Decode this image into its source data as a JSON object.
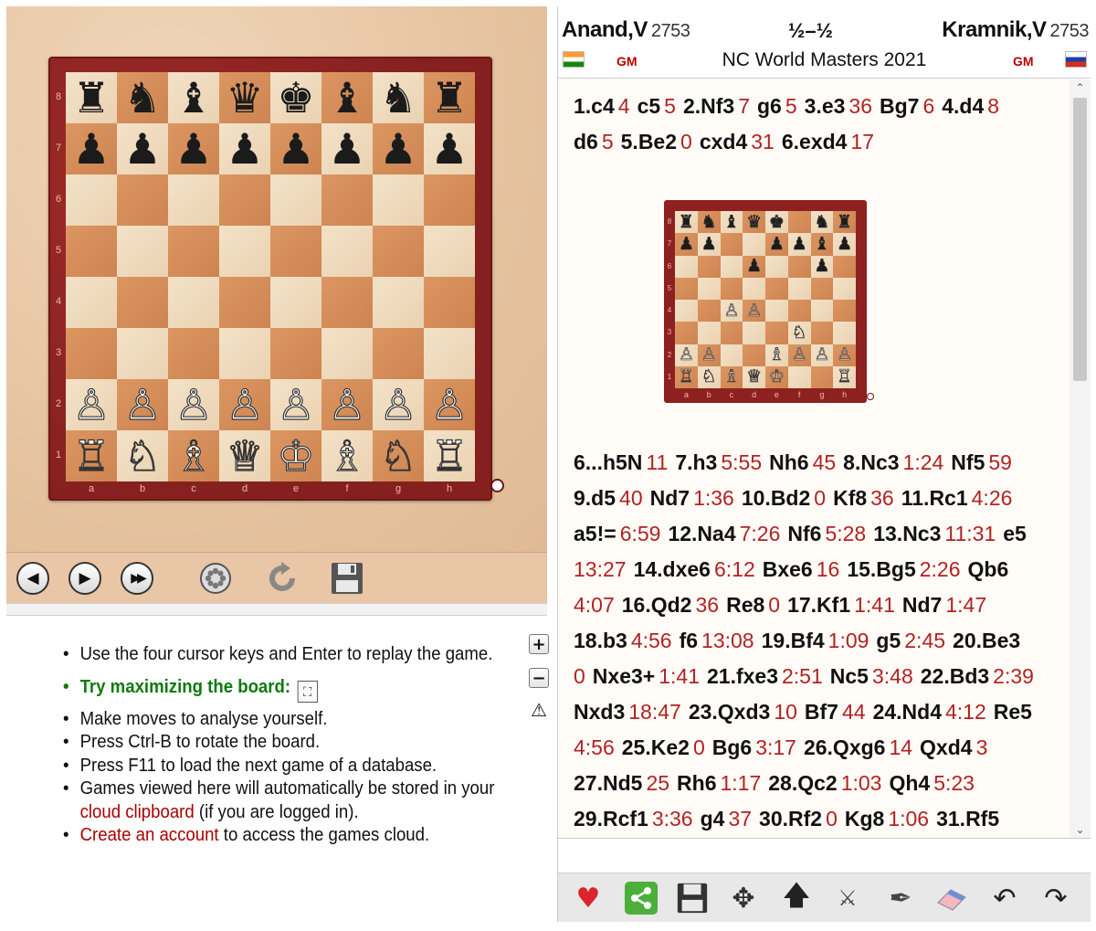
{
  "board": {
    "ranks": [
      "8",
      "7",
      "6",
      "5",
      "4",
      "3",
      "2",
      "1"
    ],
    "files": [
      "a",
      "b",
      "c",
      "d",
      "e",
      "f",
      "g",
      "h"
    ],
    "rows": [
      [
        "♜",
        "♞",
        "♝",
        "♛",
        "♚",
        "♝",
        "♞",
        "♜"
      ],
      [
        "♟",
        "♟",
        "♟",
        "♟",
        "♟",
        "♟",
        "♟",
        "♟"
      ],
      [
        "",
        "",
        "",
        "",
        "",
        "",
        "",
        ""
      ],
      [
        "",
        "",
        "",
        "",
        "",
        "",
        "",
        ""
      ],
      [
        "",
        "",
        "",
        "",
        "",
        "",
        "",
        ""
      ],
      [
        "",
        "",
        "",
        "",
        "",
        "",
        "",
        ""
      ],
      [
        "♙",
        "♙",
        "♙",
        "♙",
        "♙",
        "♙",
        "♙",
        "♙"
      ],
      [
        "♖",
        "♘",
        "♗",
        "♕",
        "♔",
        "♗",
        "♘",
        "♖"
      ]
    ]
  },
  "nav": {
    "back_icon": "arrow-left-icon",
    "forward_icon": "arrow-right-icon",
    "end_icon": "fast-forward-icon",
    "engine_icon": "engine-wheel-icon",
    "rotate_icon": "rotate-icon",
    "save_icon": "save-icon"
  },
  "info": {
    "items": [
      "Use the four cursor keys and Enter to replay the game.",
      "Try maximizing the board:",
      "Make moves to analyse yourself.",
      "Press Ctrl-B to rotate the board.",
      "Press F11 to load the next game of a database.",
      "Games viewed here will automatically be stored in your",
      "cloud clipboard",
      "(if you are logged in).",
      "Create an account",
      "to access the games cloud."
    ],
    "zoom_in": "+",
    "zoom_out": "−",
    "warning": "⚠"
  },
  "header": {
    "white_name": "Anand,V",
    "white_elo": "2753",
    "black_name": "Kramnik,V",
    "black_elo": "2753",
    "result": "½–½",
    "event": "NC World Masters 2021",
    "white_title": "GM",
    "black_title": "GM",
    "white_flag": "India",
    "black_flag": "Russia"
  },
  "notation": {
    "lines_before": [
      [
        [
          "1.c4",
          "4"
        ],
        [
          "c5",
          "5"
        ],
        [
          "2.Nf3",
          "7"
        ],
        [
          "g6",
          "5"
        ],
        [
          "3.e3",
          "36"
        ],
        [
          "Bg7",
          "6"
        ],
        [
          "4.d4",
          "8"
        ]
      ],
      [
        [
          "d6",
          "5"
        ],
        [
          "5.Be2",
          "0"
        ],
        [
          "cxd4",
          "31"
        ],
        [
          "6.exd4",
          "17"
        ]
      ]
    ],
    "lines_after": [
      [
        [
          "6...h5N",
          "11"
        ],
        [
          "7.h3",
          "5:55"
        ],
        [
          "Nh6",
          "45"
        ],
        [
          "8.Nc3",
          "1:24"
        ],
        [
          "Nf5",
          "59"
        ]
      ],
      [
        [
          "9.d5",
          "40"
        ],
        [
          "Nd7",
          "1:36"
        ],
        [
          "10.Bd2",
          "0"
        ],
        [
          "Kf8",
          "36"
        ],
        [
          "11.Rc1",
          "4:26"
        ]
      ],
      [
        [
          "a5!=",
          "6:59"
        ],
        [
          "12.Na4",
          "7:26"
        ],
        [
          "Nf6",
          "5:28"
        ],
        [
          "13.Nc3",
          "11:31"
        ],
        [
          "e5",
          ""
        ]
      ],
      [
        [
          "",
          "13:27"
        ],
        [
          "14.dxe6",
          "6:12"
        ],
        [
          "Bxe6",
          "16"
        ],
        [
          "15.Bg5",
          "2:26"
        ],
        [
          "Qb6",
          ""
        ]
      ],
      [
        [
          "",
          "4:07"
        ],
        [
          "16.Qd2",
          "36"
        ],
        [
          "Re8",
          "0"
        ],
        [
          "17.Kf1",
          "1:41"
        ],
        [
          "Nd7",
          "1:47"
        ]
      ],
      [
        [
          "18.b3",
          "4:56"
        ],
        [
          "f6",
          "13:08"
        ],
        [
          "19.Bf4",
          "1:09"
        ],
        [
          "g5",
          "2:45"
        ],
        [
          "20.Be3",
          ""
        ]
      ],
      [
        [
          "",
          "0"
        ],
        [
          "Nxe3+",
          "1:41"
        ],
        [
          "21.fxe3",
          "2:51"
        ],
        [
          "Nc5",
          "3:48"
        ],
        [
          "22.Bd3",
          "2:39"
        ]
      ],
      [
        [
          "Nxd3",
          "18:47"
        ],
        [
          "23.Qxd3",
          "10"
        ],
        [
          "Bf7",
          "44"
        ],
        [
          "24.Nd4",
          "4:12"
        ],
        [
          "Re5",
          ""
        ]
      ],
      [
        [
          "",
          "4:56"
        ],
        [
          "25.Ke2",
          "0"
        ],
        [
          "Bg6",
          "3:17"
        ],
        [
          "26.Qxg6",
          "14"
        ],
        [
          "Qxd4",
          "3"
        ]
      ],
      [
        [
          "27.Nd5",
          "25"
        ],
        [
          "Rh6",
          "1:17"
        ],
        [
          "28.Qc2",
          "1:03"
        ],
        [
          "Qh4",
          "5:23"
        ]
      ],
      [
        [
          "29.Rcf1",
          "3:36"
        ],
        [
          "g4",
          "37"
        ],
        [
          "30.Rf2",
          "0"
        ],
        [
          "Kg8",
          "1:06"
        ],
        [
          "31.Rf5",
          ""
        ]
      ]
    ],
    "mini_rows": [
      [
        "♜",
        "♞",
        "♝",
        "♛",
        "♚",
        "",
        "♞",
        "♜"
      ],
      [
        "♟",
        "♟",
        "",
        "",
        "♟",
        "♟",
        "♝",
        "♟"
      ],
      [
        "",
        "",
        "",
        "♟",
        "",
        "",
        "♟",
        ""
      ],
      [
        "",
        "",
        "",
        "",
        "",
        "",
        "",
        ""
      ],
      [
        "",
        "",
        "♙",
        "♙",
        "",
        "",
        "",
        ""
      ],
      [
        "",
        "",
        "",
        "",
        "",
        "♘",
        "",
        ""
      ],
      [
        "♙",
        "♙",
        "",
        "",
        "♗",
        "♙",
        "♙",
        "♙"
      ],
      [
        "♖",
        "♘",
        "♗",
        "♕",
        "♔",
        "",
        "",
        "♖"
      ]
    ]
  },
  "toolbar": {
    "icons": [
      "heart-icon",
      "share-icon",
      "save-icon",
      "move-icon",
      "up-arrow-icon",
      "no-engine-icon",
      "pen-icon",
      "eraser-icon",
      "undo-icon",
      "redo-icon"
    ]
  }
}
